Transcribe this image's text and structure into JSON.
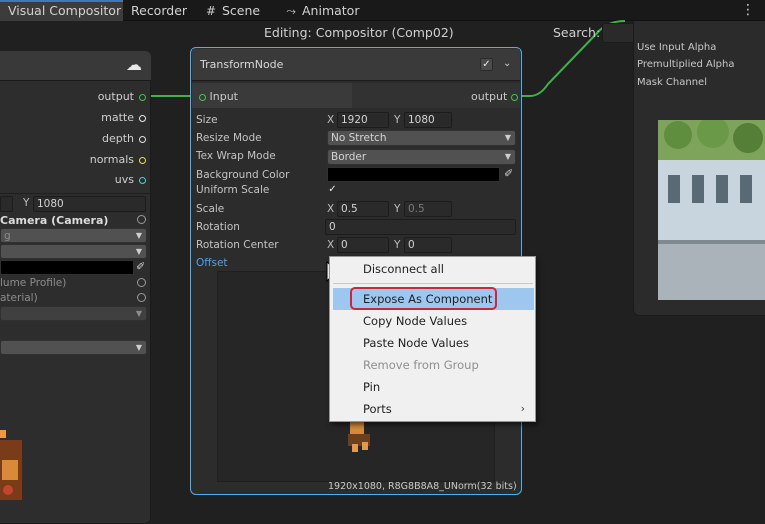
{
  "tabs": [
    {
      "label": "Visual Compositor",
      "icon": "",
      "active": true
    },
    {
      "label": "Recorder",
      "icon": "",
      "active": false
    },
    {
      "label": "Scene",
      "icon": "grid-icon",
      "active": false
    },
    {
      "label": "Animator",
      "icon": "animator-icon",
      "active": false
    }
  ],
  "toolbar": {
    "editing_title": "Editing: Compositor (Comp02)",
    "search_label": "Search:",
    "search_value": ""
  },
  "left_node": {
    "ports": [
      "output",
      "matte",
      "depth",
      "normals",
      "uvs"
    ],
    "height_label": "Y",
    "height_value": "1080",
    "camera_label": "Camera (Camera)",
    "camera_fragment": "g",
    "volume_label": "lume Profile)",
    "material_label": "aterial)"
  },
  "transform_node": {
    "title": "TransformNode",
    "input_label": "Input",
    "output_label": "output",
    "size_label": "Size",
    "size_x_label": "X",
    "size_x": "1920",
    "size_y_label": "Y",
    "size_y": "1080",
    "resize_mode_label": "Resize Mode",
    "resize_mode": "No Stretch",
    "tex_wrap_label": "Tex Wrap Mode",
    "tex_wrap": "Border",
    "bg_color_label": "Background Color",
    "uniform_scale_label": "Uniform Scale",
    "scale_label": "Scale",
    "scale_x_label": "X",
    "scale_x": "0.5",
    "scale_y_label": "Y",
    "scale_y": "0.5",
    "rotation_label": "Rotation",
    "rotation": "0",
    "rotation_center_label": "Rotation Center",
    "rc_x_label": "X",
    "rc_x": "0",
    "rc_y_label": "Y",
    "rc_y": "0",
    "offset_label": "Offset",
    "preview_info": "1920x1080, R8G8B8A8_UNorm(32 bits)"
  },
  "right_panel": {
    "items": [
      "Use Input Alpha",
      "Premultiplied Alpha",
      "Mask Channel"
    ]
  },
  "context_menu": {
    "items": [
      {
        "label": "Disconnect all",
        "disabled": false,
        "highlight": false,
        "submenu": false
      },
      {
        "label": "Expose As Component",
        "disabled": false,
        "highlight": true,
        "submenu": false
      },
      {
        "label": "Copy Node Values",
        "disabled": false,
        "highlight": false,
        "submenu": false
      },
      {
        "label": "Paste Node Values",
        "disabled": false,
        "highlight": false,
        "submenu": false
      },
      {
        "label": "Remove from Group",
        "disabled": true,
        "highlight": false,
        "submenu": false
      },
      {
        "label": "Pin",
        "disabled": false,
        "highlight": false,
        "submenu": false
      },
      {
        "label": "Ports",
        "disabled": false,
        "highlight": false,
        "submenu": true
      }
    ]
  },
  "colors": {
    "accent": "#48b3f0",
    "highlight": "#9ec7f0",
    "outline": "#c9283a",
    "edge": "#3fb04a"
  }
}
